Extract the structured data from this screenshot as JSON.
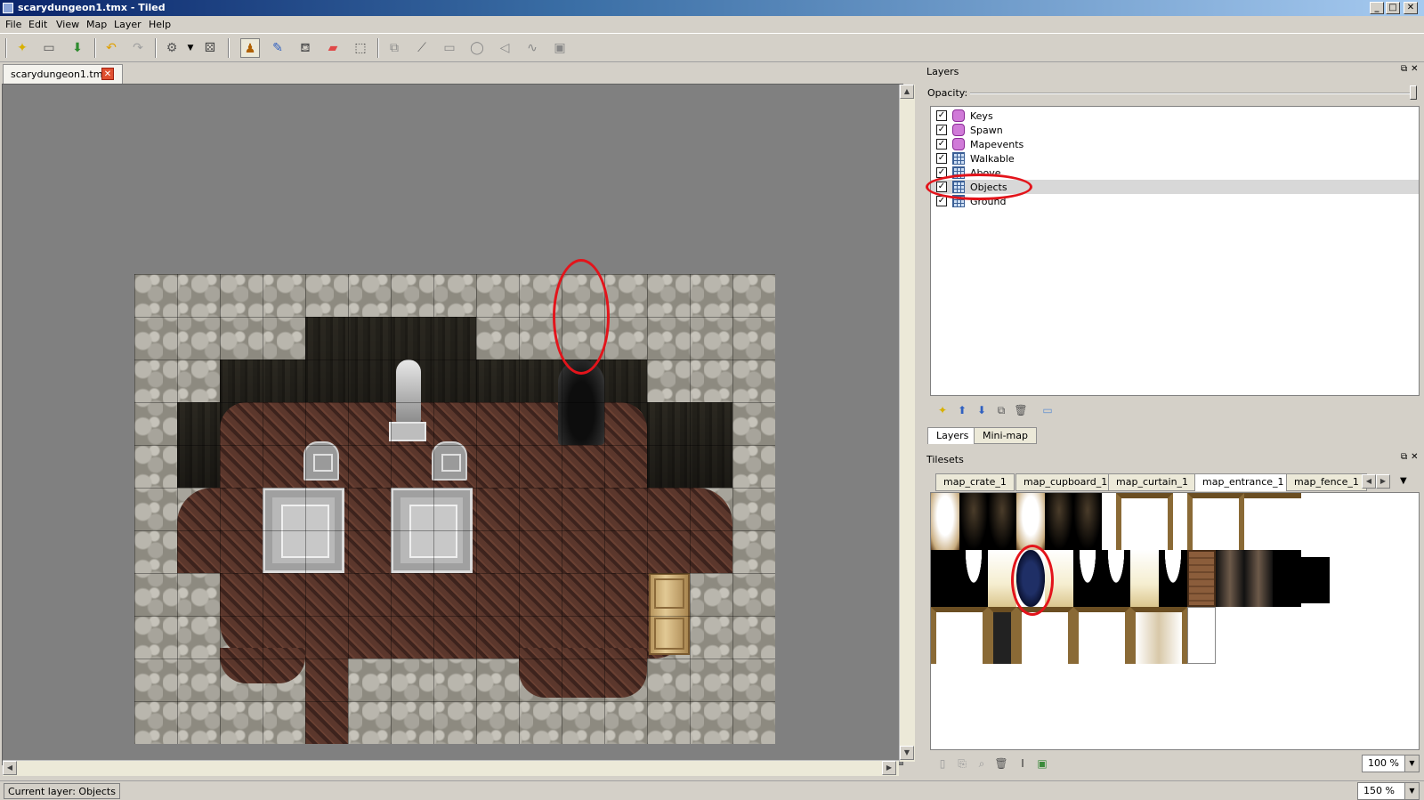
{
  "window": {
    "title": "scarydungeon1.tmx - Tiled",
    "controls": {
      "minimize": "_",
      "maximize": "□",
      "close": "✕"
    }
  },
  "menu": [
    "File",
    "Edit",
    "View",
    "Map",
    "Layer",
    "Help"
  ],
  "toolbar": {
    "icons": [
      "new-icon",
      "open-icon",
      "save-icon",
      "undo-icon",
      "redo-icon",
      "command-icon",
      "random-icon",
      "stamp-brush-icon",
      "terrain-brush-icon",
      "bucket-fill-icon",
      "eraser-icon",
      "rectangle-select-icon",
      "select-objects-icon",
      "edit-polygons-icon",
      "insert-rectangle-icon",
      "insert-ellipse-icon",
      "insert-polygon-icon",
      "insert-polyline-icon",
      "insert-tile-icon"
    ]
  },
  "document_tab": {
    "label": "scarydungeon1.tmx",
    "close": "✕"
  },
  "layers_panel": {
    "title": "Layers",
    "opacity_label": "Opacity:",
    "opacity": 1.0,
    "layers": [
      {
        "name": "Keys",
        "type": "object",
        "visible": true
      },
      {
        "name": "Spawn",
        "type": "object",
        "visible": true
      },
      {
        "name": "Mapevents",
        "type": "object",
        "visible": true
      },
      {
        "name": "Walkable",
        "type": "tile",
        "visible": true
      },
      {
        "name": "Above",
        "type": "tile",
        "visible": true
      },
      {
        "name": "Objects",
        "type": "tile",
        "visible": true,
        "selected": true
      },
      {
        "name": "Ground",
        "type": "tile",
        "visible": true
      }
    ],
    "tabs": [
      "Layers",
      "Mini-map"
    ]
  },
  "tilesets_panel": {
    "title": "Tilesets",
    "tabs": [
      "map_crate_1",
      "map_cupboard_1",
      "map_curtain_1",
      "map_entrance_1",
      "map_fence_1"
    ],
    "active_tab": "map_entrance_1",
    "zoom": "100 %"
  },
  "map_zoom": "150 %",
  "status": {
    "text": "Current layer: Objects"
  },
  "colors": {
    "annotation": "#e3141b",
    "title_gradient_start": "#0a246a"
  }
}
